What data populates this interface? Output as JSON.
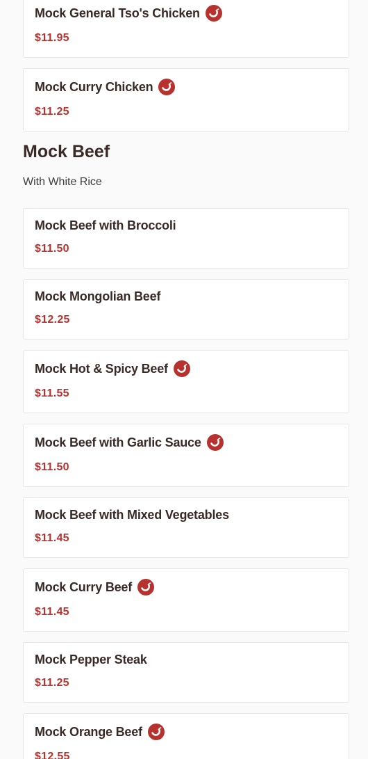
{
  "colors": {
    "price": "#b7322e",
    "spicy_icon": "#b7322e",
    "text": "#3a2a26",
    "card_border": "#e6e6e6",
    "background": "#fafafa"
  },
  "chicken_items": [
    {
      "name": "Mock General Tso's Chicken",
      "price": "$11.95",
      "spicy": true
    },
    {
      "name": "Mock Curry Chicken",
      "price": "$11.25",
      "spicy": true
    }
  ],
  "section": {
    "title": "Mock Beef",
    "subtitle": "With White Rice"
  },
  "beef_items": [
    {
      "name": "Mock Beef with Broccoli",
      "price": "$11.50",
      "spicy": false
    },
    {
      "name": "Mock Mongolian Beef",
      "price": "$12.25",
      "spicy": false
    },
    {
      "name": "Mock Hot & Spicy Beef",
      "price": "$11.55",
      "spicy": true
    },
    {
      "name": "Mock Beef with Garlic Sauce",
      "price": "$11.50",
      "spicy": true
    },
    {
      "name": "Mock Beef with Mixed Vegetables",
      "price": "$11.45",
      "spicy": false
    },
    {
      "name": "Mock Curry Beef",
      "price": "$11.45",
      "spicy": true
    },
    {
      "name": "Mock Pepper Steak",
      "price": "$11.25",
      "spicy": false
    },
    {
      "name": "Mock Orange Beef",
      "price": "$12.55",
      "spicy": true
    }
  ]
}
